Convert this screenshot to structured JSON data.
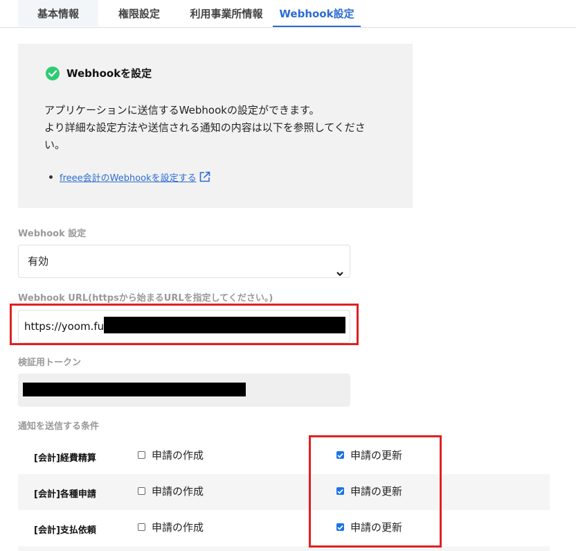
{
  "tabs": [
    {
      "label": "基本情報"
    },
    {
      "label": "権限設定"
    },
    {
      "label": "利用事業所情報"
    },
    {
      "label": "Webhook設定"
    }
  ],
  "info": {
    "title": "Webhookを設定",
    "desc_line1": "アプリケーションに送信するWebhookの設定ができます。",
    "desc_line2": "より詳細な設定方法や送信される通知の内容は以下を参照してください。",
    "link": "freee会計のWebhookを設定する"
  },
  "form": {
    "webhook_setting_label": "Webhook 設定",
    "webhook_setting_value": "有効",
    "url_label": "Webhook URL(httpsから始まるURLを指定してください。)",
    "url_value": "https://yoom.fun/",
    "token_label": "検証用トークン",
    "conditions_label": "通知を送信する条件"
  },
  "conditions": [
    {
      "name": "[会計]経費精算",
      "create_label": "申請の作成",
      "create_checked": false,
      "update_label": "申請の更新",
      "update_checked": true
    },
    {
      "name": "[会計]各種申請",
      "create_label": "申請の作成",
      "create_checked": false,
      "update_label": "申請の更新",
      "update_checked": true
    },
    {
      "name": "[会計]支払依頼",
      "create_label": "申請の作成",
      "create_checked": false,
      "update_label": "申請の更新",
      "update_checked": true
    }
  ],
  "colors": {
    "accent": "#2a6bd4",
    "highlight": "#e02020",
    "success": "#2ecc71"
  }
}
